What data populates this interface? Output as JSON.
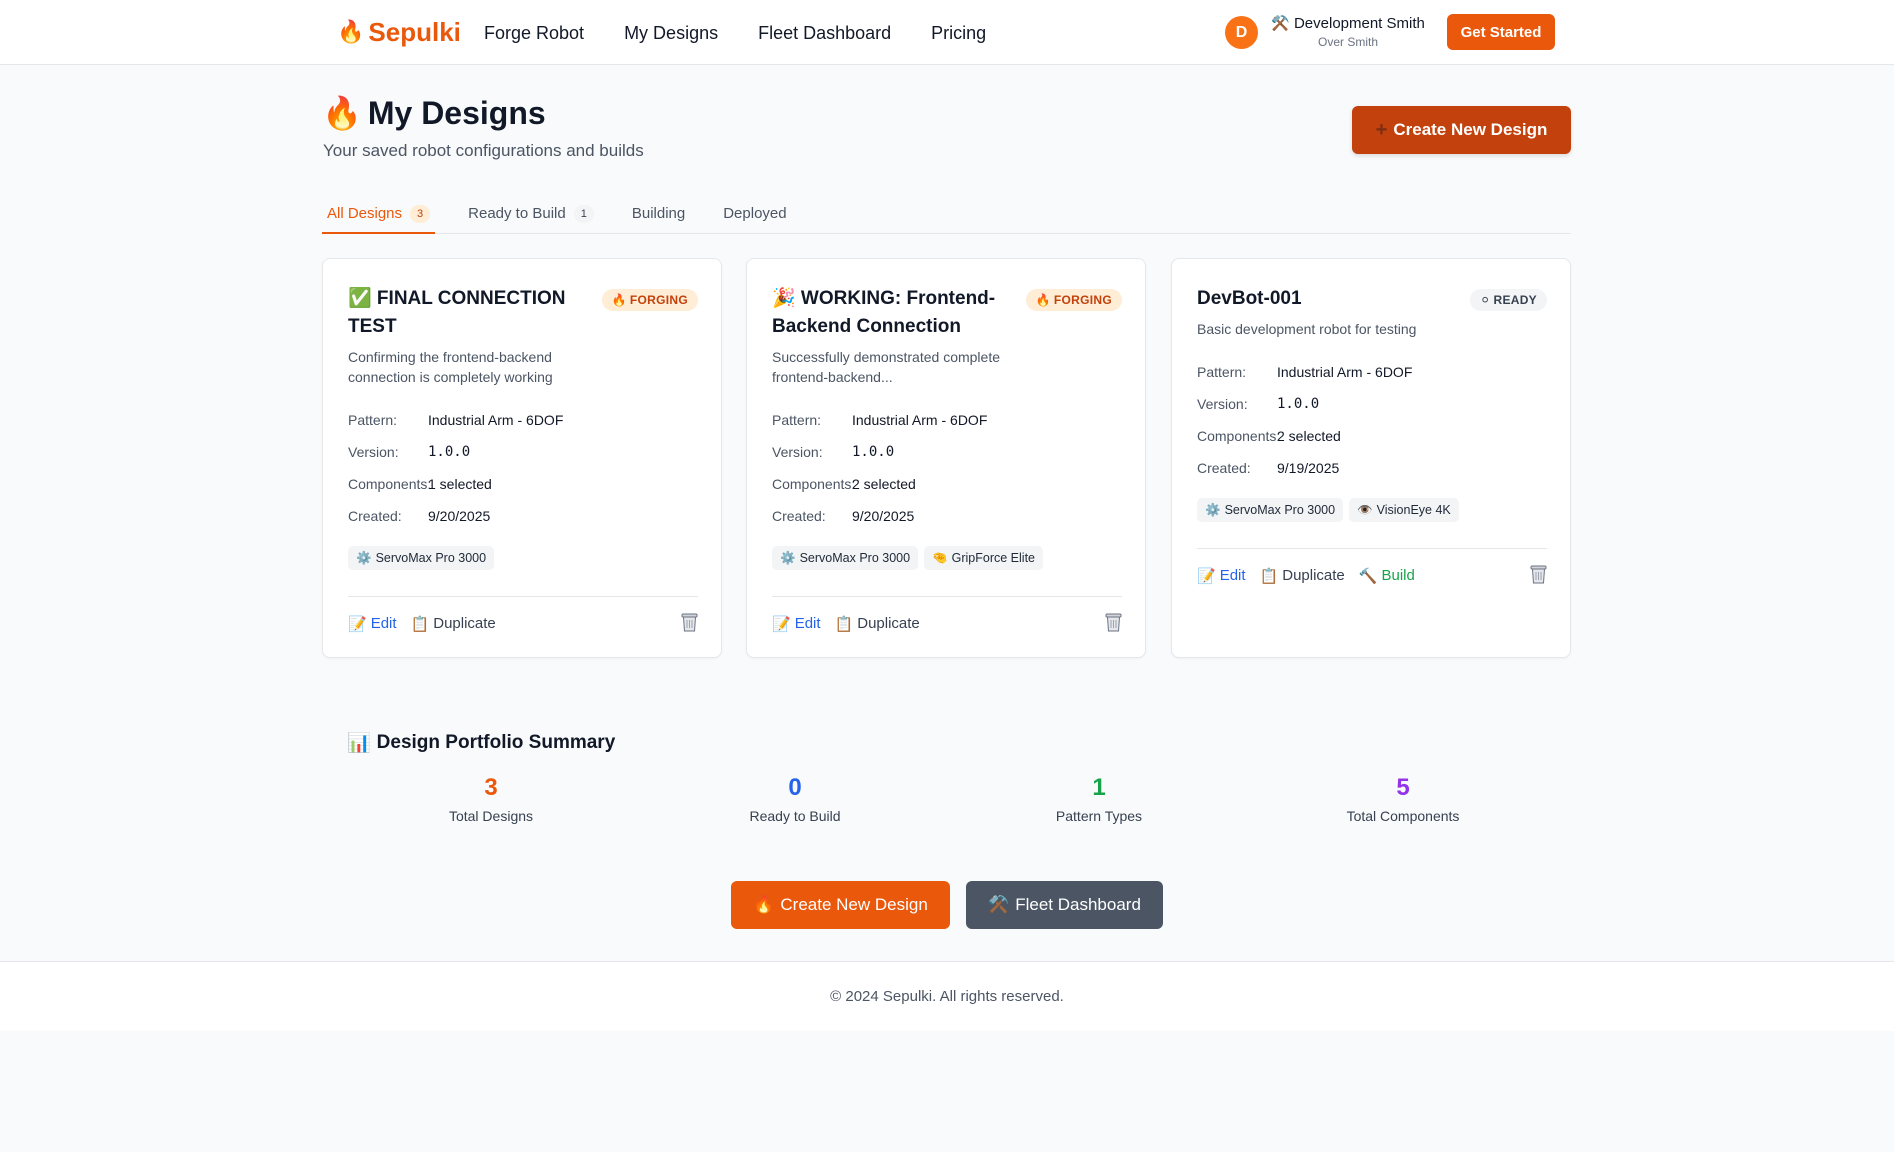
{
  "header": {
    "brand_icon": "🔥",
    "brand": "Sepulki",
    "nav": [
      "Forge Robot",
      "My Designs",
      "Fleet Dashboard",
      "Pricing"
    ],
    "user_initial": "D",
    "user_icon": "⚒️",
    "user_name": "Development Smith",
    "user_subtitle": "Over Smith",
    "cta": "Get Started"
  },
  "page": {
    "title_icon": "🔥",
    "title": "My Designs",
    "subtitle": "Your saved robot configurations and builds",
    "create_icon": "➕",
    "create_label": "Create New Design"
  },
  "tabs": [
    {
      "label": "All Designs",
      "count": "3",
      "active": true
    },
    {
      "label": "Ready to Build",
      "count": "1",
      "active": false
    },
    {
      "label": "Building",
      "count": "",
      "active": false
    },
    {
      "label": "Deployed",
      "count": "",
      "active": false
    }
  ],
  "spec_labels": {
    "pattern": "Pattern:",
    "version": "Version:",
    "components": "Components:",
    "created": "Created:"
  },
  "cards": [
    {
      "title": "✅ FINAL CONNECTION TEST",
      "status_icon": "🔥",
      "status": "FORGING",
      "description": "Confirming the frontend-backend connection is completely working",
      "pattern": "Industrial Arm - 6DOF",
      "version": "1.0.0",
      "components": "1 selected",
      "created": "9/20/2025",
      "component_tags": [
        {
          "icon": "⚙️",
          "name": "ServoMax Pro 3000"
        }
      ],
      "actions": {
        "edit": "Edit",
        "duplicate": "Duplicate"
      }
    },
    {
      "title": "🎉 WORKING: Frontend-Backend Connection",
      "status_icon": "🔥",
      "status": "FORGING",
      "description": "Successfully demonstrated complete frontend-backend...",
      "pattern": "Industrial Arm - 6DOF",
      "version": "1.0.0",
      "components": "2 selected",
      "created": "9/20/2025",
      "component_tags": [
        {
          "icon": "⚙️",
          "name": "ServoMax Pro 3000"
        },
        {
          "icon": "🤏",
          "name": "GripForce Elite"
        }
      ],
      "actions": {
        "edit": "Edit",
        "duplicate": "Duplicate"
      }
    },
    {
      "title": "DevBot-001",
      "status_icon": "⚪",
      "status": "READY",
      "description": "Basic development robot for testing",
      "pattern": "Industrial Arm - 6DOF",
      "version": "1.0.0",
      "components": "2 selected",
      "created": "9/19/2025",
      "component_tags": [
        {
          "icon": "⚙️",
          "name": "ServoMax Pro 3000"
        },
        {
          "icon": "👁️",
          "name": "VisionEye 4K"
        }
      ],
      "actions": {
        "edit": "Edit",
        "duplicate": "Duplicate",
        "build": "Build"
      }
    }
  ],
  "summary": {
    "title_icon": "📊",
    "title": "Design Portfolio Summary",
    "stats": [
      {
        "value": "3",
        "label": "Total Designs",
        "color": "#ea580c"
      },
      {
        "value": "0",
        "label": "Ready to Build",
        "color": "#2563eb"
      },
      {
        "value": "1",
        "label": "Pattern Types",
        "color": "#16a34a"
      },
      {
        "value": "5",
        "label": "Total Components",
        "color": "#9333ea"
      }
    ]
  },
  "bottom_buttons": {
    "create_icon": "🔥",
    "create_label": "Create New Design",
    "fleet_icon": "⚒️",
    "fleet_label": "Fleet Dashboard"
  },
  "footer": {
    "text": "© 2024 Sepulki. All rights reserved."
  },
  "icons": {
    "edit": "📝",
    "duplicate": "📋",
    "build": "🔨",
    "trash": "trash-icon"
  },
  "colors": {
    "brand": "#ea580c",
    "brand_dark": "#c2410c",
    "link": "#2563eb",
    "success": "#16a34a",
    "secondary_button": "#4b5563"
  }
}
